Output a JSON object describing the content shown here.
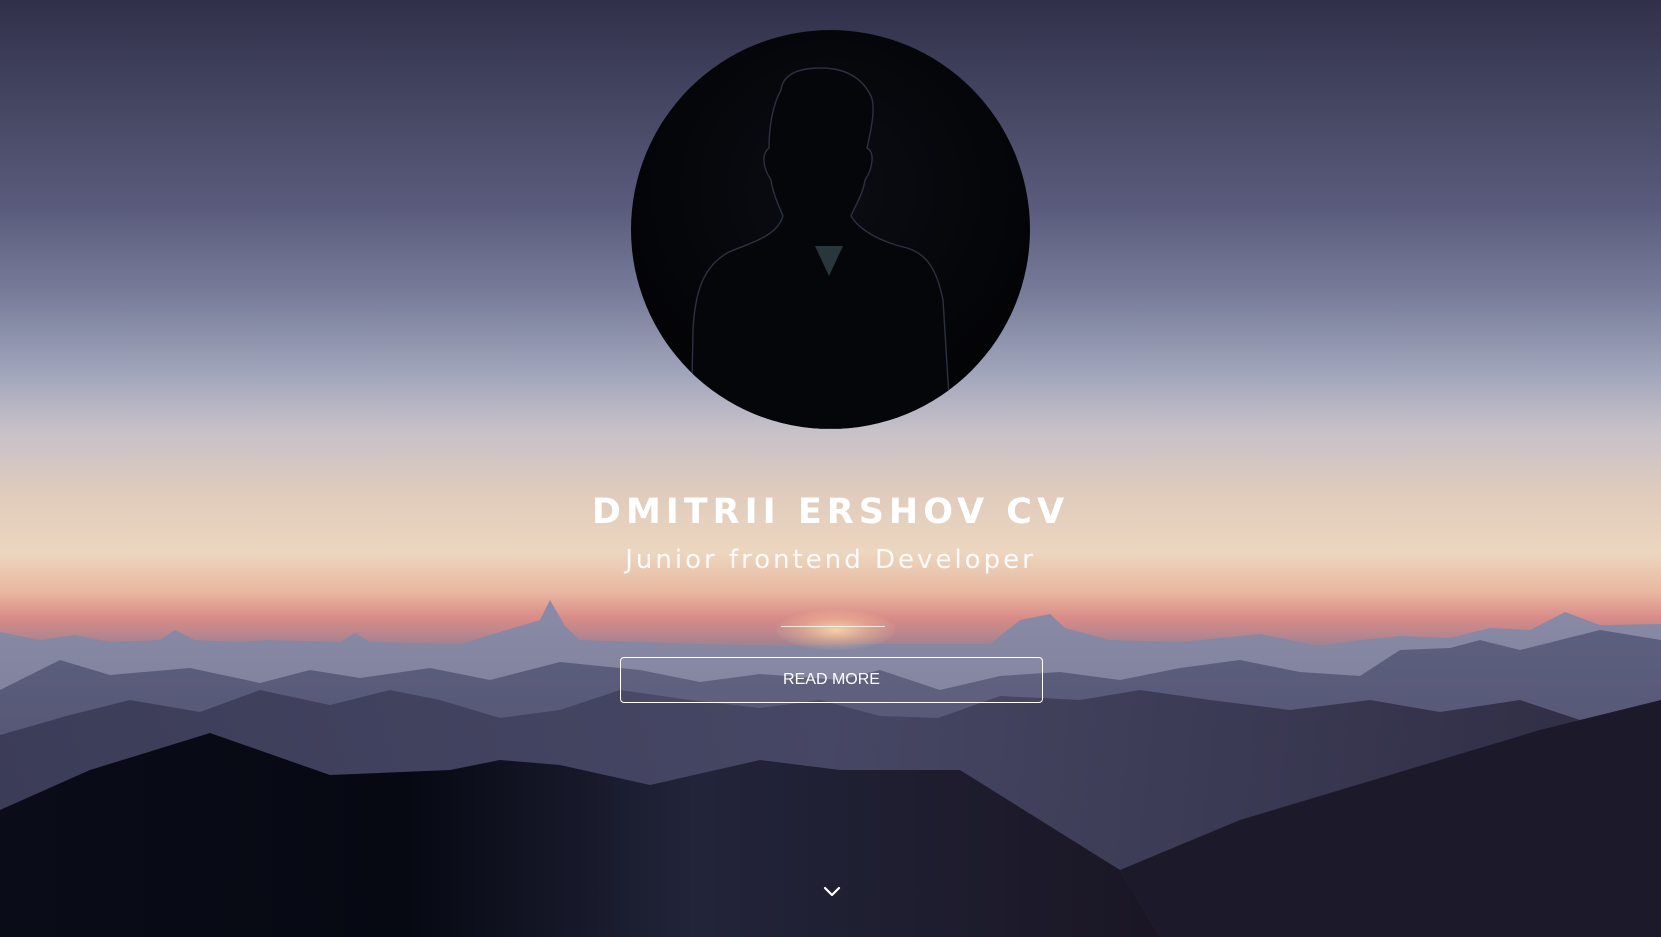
{
  "hero": {
    "title": "DMITRII ERSHOV CV",
    "subtitle": "Junior frontend Developer",
    "read_more_label": "READ MORE"
  },
  "avatar": {
    "icon": "person-silhouette"
  },
  "scroll": {
    "icon": "chevron-down-icon"
  },
  "colors": {
    "text": "#ffffff",
    "sky_top": "#30304a",
    "horizon": "#ecd6bf",
    "horizon_pink": "#d98b87",
    "mountains_dark": "#0b0d1a"
  }
}
